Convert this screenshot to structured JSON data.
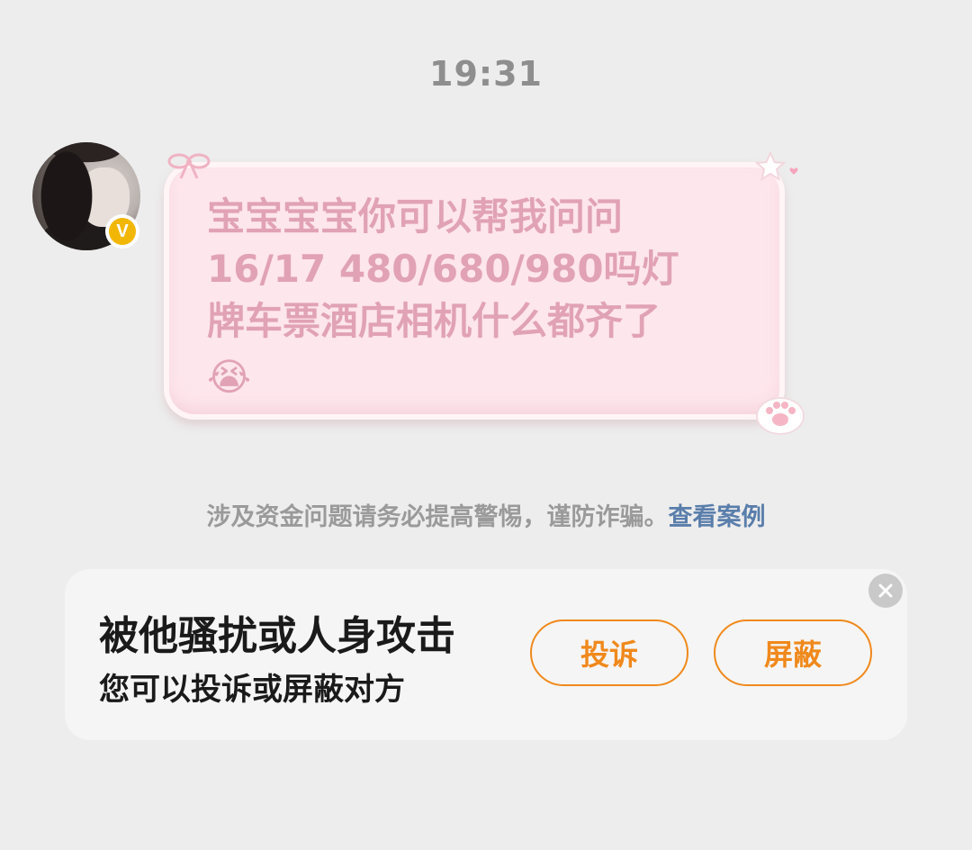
{
  "status": {
    "time": "19:31"
  },
  "message": {
    "line1": "宝宝宝宝你可以帮我问问",
    "line2": "16/17  480/680/980吗灯",
    "line3": "牌车票酒店相机什么都齐了",
    "emoji": "😭"
  },
  "avatar": {
    "badge": "V"
  },
  "warning": {
    "text": "涉及资金问题请务必提高警惕，谨防诈骗。",
    "link": "查看案例"
  },
  "report": {
    "title": "被他骚扰或人身攻击",
    "subtitle": "您可以投诉或屏蔽对方",
    "complain_label": "投诉",
    "block_label": "屏蔽"
  },
  "colors": {
    "bubble_bg": "#fde6ec",
    "bubble_text": "#e1a2b6",
    "accent_orange": "#f0891c",
    "link_blue": "#5a7eab",
    "badge_yellow": "#f2b705"
  },
  "icons": {
    "verified": "verified-badge-icon",
    "bow": "bow-decoration-icon",
    "star": "star-heart-decoration-icon",
    "paw": "paw-decoration-icon",
    "close": "close-icon"
  }
}
